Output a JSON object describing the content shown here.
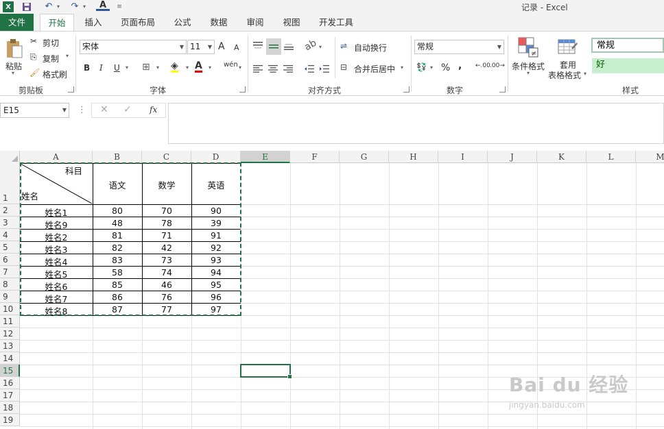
{
  "window": {
    "title": "记录 - Excel"
  },
  "tabs": [
    {
      "label": "文件"
    },
    {
      "label": "开始"
    },
    {
      "label": "插入"
    },
    {
      "label": "页面布局"
    },
    {
      "label": "公式"
    },
    {
      "label": "数据"
    },
    {
      "label": "审阅"
    },
    {
      "label": "视图"
    },
    {
      "label": "开发工具"
    }
  ],
  "ribbon": {
    "clipboard": {
      "paste": "粘贴",
      "cut": "剪切",
      "copy": "复制",
      "painter": "格式刷",
      "label": "剪贴板"
    },
    "font": {
      "name": "宋体",
      "size": "11",
      "label": "字体",
      "bold": "B",
      "italic": "I",
      "underline": "U",
      "grow": "A",
      "shrink": "A",
      "phonetic": "wén"
    },
    "align": {
      "wrap": "自动换行",
      "merge": "合并后居中",
      "label": "对齐方式"
    },
    "number": {
      "format": "常规",
      "percent": "%",
      "comma": ",",
      "inc_decimal": ".00",
      "dec_decimal": ".00",
      "label": "数字"
    },
    "styles": {
      "conditional": "条件格式",
      "table_format_1": "套用",
      "table_format_2": "表格格式",
      "normal": "常规",
      "good": "好",
      "label": "样式"
    }
  },
  "formula_bar": {
    "name_box": "E15",
    "fx": "fx",
    "value": ""
  },
  "columns": [
    "A",
    "B",
    "C",
    "D",
    "E",
    "F",
    "G",
    "H",
    "I",
    "J",
    "K",
    "L",
    "M"
  ],
  "rows": [
    "1",
    "2",
    "3",
    "4",
    "5",
    "6",
    "7",
    "8",
    "9",
    "10",
    "11",
    "12",
    "13",
    "14",
    "15",
    "16",
    "17",
    "18",
    "19"
  ],
  "table": {
    "header_top": "科目",
    "header_bottom": "姓名",
    "subjects": [
      "语文",
      "数学",
      "英语"
    ],
    "rows": [
      {
        "name": "姓名1",
        "chinese": "80",
        "math": "70",
        "english": "90"
      },
      {
        "name": "姓名9",
        "chinese": "48",
        "math": "78",
        "english": "39"
      },
      {
        "name": "姓名2",
        "chinese": "81",
        "math": "71",
        "english": "91"
      },
      {
        "name": "姓名3",
        "chinese": "82",
        "math": "42",
        "english": "92"
      },
      {
        "name": "姓名4",
        "chinese": "83",
        "math": "73",
        "english": "93"
      },
      {
        "name": "姓名5",
        "chinese": "58",
        "math": "74",
        "english": "94"
      },
      {
        "name": "姓名6",
        "chinese": "85",
        "math": "46",
        "english": "95"
      },
      {
        "name": "姓名7",
        "chinese": "86",
        "math": "76",
        "english": "96"
      },
      {
        "name": "姓名8",
        "chinese": "87",
        "math": "77",
        "english": "97"
      }
    ]
  },
  "watermark": {
    "main": "Bai du 经验",
    "sub": "jingyan.baidu.com"
  },
  "colors": {
    "accent": "#217346",
    "good_fill": "#c6efce",
    "good_text": "#006100"
  }
}
